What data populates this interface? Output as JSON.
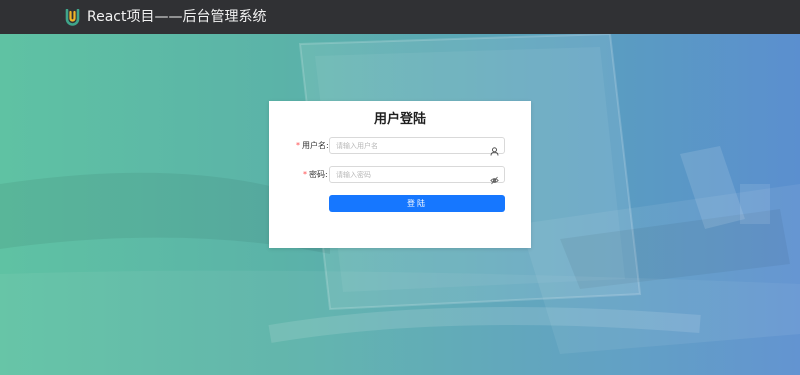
{
  "header": {
    "title": "React项目——后台管理系统",
    "logo_icon": "logo-icon",
    "background": "#303134"
  },
  "login": {
    "title": "用户登陆",
    "username": {
      "label": "用户名:",
      "required_mark": "*",
      "placeholder": "请输入用户名",
      "value": "",
      "icon": "user-icon"
    },
    "password": {
      "label": "密码:",
      "required_mark": "*",
      "placeholder": "请输入密码",
      "value": "",
      "icon": "eye-invisible-icon"
    },
    "submit_label": "登陆"
  },
  "colors": {
    "primary": "#1677ff",
    "required": "#ff4d4f",
    "gradient_start": "#5fc2a3",
    "gradient_end": "#5b8fcf"
  }
}
